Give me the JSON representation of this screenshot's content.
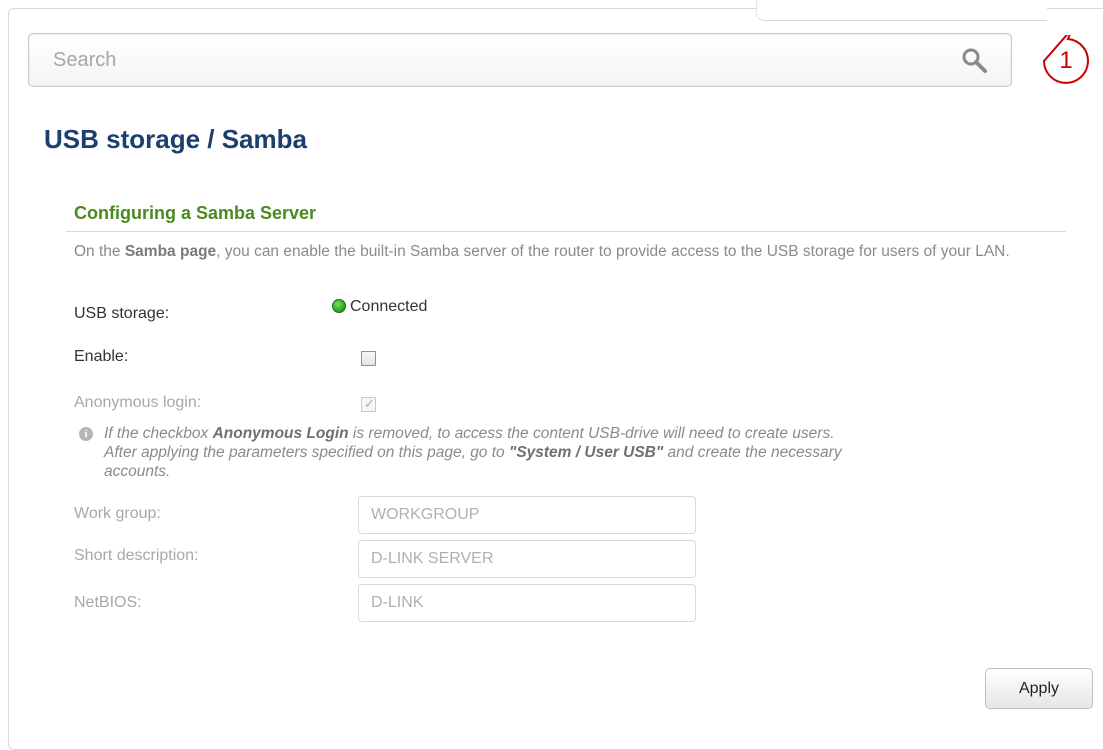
{
  "search": {
    "placeholder": "Search"
  },
  "callout": {
    "number": "1"
  },
  "page": {
    "title": "USB storage /  Samba"
  },
  "section": {
    "heading": "Configuring a Samba Server",
    "intro_prefix": "On the ",
    "intro_bold": "Samba page",
    "intro_suffix": ", you can enable the built-in Samba server of the router to provide access to the USB storage for users of your LAN."
  },
  "usb_storage": {
    "label": "USB storage:",
    "status": "Connected",
    "status_color": "#20a020"
  },
  "enable": {
    "label": "Enable:",
    "checked": false
  },
  "anonymous_login": {
    "label": "Anonymous login:",
    "checked": true
  },
  "note": {
    "part1": "If the checkbox ",
    "bold1": "Anonymous Login",
    "part2": " is removed, to access the content USB-drive will need to create users. After applying the parameters specified on this page, go to ",
    "bold2": "\"System / User USB\"",
    "part3": " and create the necessary accounts."
  },
  "work_group": {
    "label": "Work group:",
    "value": "WORKGROUP"
  },
  "short_description": {
    "label": "Short description:",
    "value": "D-LINK SERVER"
  },
  "netbios": {
    "label": "NetBIOS:",
    "value": "D-LINK"
  },
  "apply_button": {
    "label": "Apply"
  },
  "colors": {
    "title": "#1c3f6e",
    "heading": "#4a8a1e",
    "callout": "#cc0000"
  }
}
